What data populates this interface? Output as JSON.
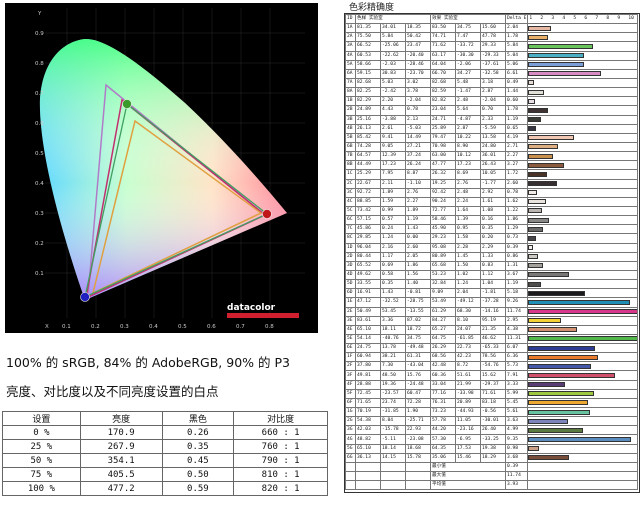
{
  "chromaticity": {
    "axis_x_label": "X",
    "axis_y_label": "Y",
    "x_ticks": [
      "0.1",
      "0.2",
      "0.3",
      "0.4",
      "0.5",
      "0.6",
      "0.7",
      "0.8"
    ],
    "y_ticks": [
      "0.9",
      "0.8",
      "0.7",
      "0.6",
      "0.5",
      "0.4",
      "0.3",
      "0.2",
      "0.1"
    ],
    "brand": "datacolor"
  },
  "caption_gamut": "100% 的 sRGB, 84% 的 AdobeRGB, 90% 的 P3",
  "caption_white": "亮度、对比度以及不同亮度设置的白点",
  "brightness_table": {
    "headers": [
      "设置",
      "亮度",
      "黑色",
      "对比度"
    ],
    "rows": [
      [
        "0 %",
        "170.9",
        "0.26",
        "660 : 1"
      ],
      [
        "25 %",
        "267.9",
        "0.35",
        "760 : 1"
      ],
      [
        "50 %",
        "354.1",
        "0.45",
        "790 : 1"
      ],
      [
        "75 %",
        "405.5",
        "0.50",
        "810 : 1"
      ],
      [
        "100 %",
        "477.2",
        "0.59",
        "820 : 1"
      ]
    ]
  },
  "delta_e": {
    "title": "色彩精确度",
    "header": [
      "ID",
      "色样",
      "实验室",
      "",
      "效果",
      "实验室",
      "",
      "Delta E"
    ],
    "scale": [
      "1",
      "2",
      "3",
      "4",
      "5",
      "6",
      "7",
      "8",
      "9",
      "10"
    ],
    "rows": [
      {
        "id": "1A",
        "v": [
          "81.35",
          "34.01",
          "18.35",
          "83.50",
          "34.75",
          "15.60"
        ],
        "de": "2.04",
        "c": "#e7b8a4"
      },
      {
        "id": "2A",
        "v": [
          "75.50",
          "5.84",
          "50.42",
          "74.71",
          "7.47",
          "47.78"
        ],
        "de": "1.78",
        "c": "#e9b06a"
      },
      {
        "id": "3A",
        "v": [
          "66.52",
          "-25.06",
          "23.47",
          "71.62",
          "-33.72",
          "29.33"
        ],
        "de": "5.84",
        "c": "#6ac45c"
      },
      {
        "id": "4A",
        "v": [
          "60.53",
          "-22.62",
          "-20.40",
          "63.17",
          "-30.30",
          "-29.33"
        ],
        "de": "5.04",
        "c": "#4aaec4"
      },
      {
        "id": "5A",
        "v": [
          "58.66",
          "-2.03",
          "-28.46",
          "64.04",
          "-2.06",
          "-37.61",
          "7.60"
        ],
        "de": "5.06",
        "c": "#7c9ed8"
      },
      {
        "id": "6A",
        "v": [
          "59.15",
          "30.83",
          "-23.70",
          "66.70",
          "34.27",
          "-32.58"
        ],
        "de": "6.61",
        "c": "#d88cc4"
      },
      {
        "id": "7A",
        "v": [
          "82.68",
          "5.03",
          "3.02",
          "82.68",
          "5.48",
          "3.18"
        ],
        "de": "0.49",
        "c": "#e8dcd6"
      },
      {
        "id": "8A",
        "v": [
          "82.25",
          "-2.42",
          "3.78",
          "82.59",
          "-1.47",
          "2.87"
        ],
        "de": "1.44",
        "c": "#e0e0d8"
      },
      {
        "id": "1B",
        "v": [
          "82.29",
          "2.20",
          "-2.04",
          "82.82",
          "2.48",
          "-2.04"
        ],
        "de": "0.60",
        "c": "#e8e0e6"
      },
      {
        "id": "2B",
        "v": [
          "24.89",
          "4.43",
          "0.78",
          "23.04",
          "5.64",
          "0.70"
        ],
        "de": "1.78",
        "c": "#3e3232"
      },
      {
        "id": "3B",
        "v": [
          "25.16",
          "-3.88",
          "2.13",
          "24.71",
          "-4.87",
          "2.33"
        ],
        "de": "1.19",
        "c": "#383c34"
      },
      {
        "id": "4B",
        "v": [
          "26.13",
          "2.61",
          "-5.03",
          "25.89",
          "2.87",
          "-5.59"
        ],
        "de": "0.65",
        "c": "#363642"
      },
      {
        "id": "5B",
        "v": [
          "85.42",
          "9.41",
          "14.49",
          "79.47",
          "10.22",
          "13.58"
        ],
        "de": "4.19",
        "c": "#f2c8b4"
      },
      {
        "id": "6B",
        "v": [
          "74.28",
          "9.05",
          "27.21",
          "70.98",
          "8.90",
          "24.80"
        ],
        "de": "2.71",
        "c": "#dcae82"
      },
      {
        "id": "7B",
        "v": [
          "64.57",
          "12.39",
          "37.24",
          "63.00",
          "10.12",
          "36.01"
        ],
        "de": "2.27",
        "c": "#c8904c"
      },
      {
        "id": "8B",
        "v": [
          "44.49",
          "17.23",
          "26.24",
          "47.77",
          "17.23",
          "26.43"
        ],
        "de": "3.27",
        "c": "#8c5a3c"
      },
      {
        "id": "1C",
        "v": [
          "25.29",
          "7.95",
          "8.87",
          "26.32",
          "8.69",
          "10.05"
        ],
        "de": "1.72",
        "c": "#4a3428"
      },
      {
        "id": "2C",
        "v": [
          "22.67",
          "2.11",
          "-1.10",
          "19.25",
          "2.76",
          "-1.77"
        ],
        "de": "2.60",
        "c": "#362e30"
      },
      {
        "id": "3C",
        "v": [
          "92.72",
          "1.89",
          "2.76",
          "92.42",
          "2.48",
          "2.92"
        ],
        "de": "0.78",
        "c": "#f2eae4"
      },
      {
        "id": "4C",
        "v": [
          "88.85",
          "1.59",
          "2.27",
          "90.24",
          "2.24",
          "1.61"
        ],
        "de": "1.62",
        "c": "#eae4de"
      },
      {
        "id": "5C",
        "v": [
          "73.42",
          "0.99",
          "1.89",
          "72.77",
          "1.64",
          "1.08"
        ],
        "de": "1.22",
        "c": "#bcb6b2"
      },
      {
        "id": "6C",
        "v": [
          "57.15",
          "0.57",
          "1.19",
          "58.46",
          "1.39",
          "0.16"
        ],
        "de": "1.86",
        "c": "#8a8886"
      },
      {
        "id": "7C",
        "v": [
          "45.86",
          "0.24",
          "1.43",
          "45.90",
          "0.95",
          "0.35"
        ],
        "de": "1.29",
        "c": "#6c6a68"
      },
      {
        "id": "8C",
        "v": [
          "29.85",
          "1.24",
          "0.00",
          "29.23",
          "1.58",
          "0.20"
        ],
        "de": "0.73",
        "c": "#48464a"
      },
      {
        "id": "1D",
        "v": [
          "96.04",
          "2.16",
          "2.60",
          "95.08",
          "2.28",
          "2.29"
        ],
        "de": "0.39",
        "c": "#f6f0ec"
      },
      {
        "id": "2D",
        "v": [
          "80.44",
          "1.17",
          "2.05",
          "80.89",
          "1.45",
          "1.33"
        ],
        "de": "0.86",
        "c": "#ccc8c4"
      },
      {
        "id": "3D",
        "v": [
          "65.52",
          "0.69",
          "1.86",
          "65.68",
          "1.50",
          "0.83"
        ],
        "de": "1.31",
        "c": "#a4a09c"
      },
      {
        "id": "4D",
        "v": [
          "49.62",
          "0.58",
          "1.56",
          "53.23",
          "1.02",
          "1.12"
        ],
        "de": "3.67",
        "c": "#7a7876"
      },
      {
        "id": "5D",
        "v": [
          "33.55",
          "0.35",
          "1.40",
          "32.84",
          "1.24",
          "1.04"
        ],
        "de": "1.19",
        "c": "#504e4c"
      },
      {
        "id": "6D",
        "v": [
          "16.91",
          "1.43",
          "-0.81",
          "9.09",
          "2.04",
          "-1.81"
        ],
        "de": "5.18",
        "c": "#1a1a1c"
      },
      {
        "id": "1E",
        "v": [
          "47.12",
          "-32.52",
          "-28.75",
          "53.49",
          "-49.12",
          "-37.28"
        ],
        "de": "9.26",
        "c": "#1e8eb4"
      },
      {
        "id": "2E",
        "v": [
          "50.49",
          "53.45",
          "-13.55",
          "61.29",
          "68.30",
          "-14.16"
        ],
        "de": "11.74",
        "c": "#d8388c"
      },
      {
        "id": "3E",
        "v": [
          "83.61",
          "3.36",
          "87.02",
          "84.27",
          "8.10",
          "95.19"
        ],
        "de": "2.95",
        "c": "#f2d234"
      },
      {
        "id": "4E",
        "v": [
          "65.10",
          "18.11",
          "18.72",
          "65.27",
          "24.07",
          "21.35"
        ],
        "de": "4.38",
        "c": "#d29070"
      },
      {
        "id": "5E",
        "v": [
          "54.14",
          "-40.76",
          "34.75",
          "64.75",
          "-61.85",
          "46.62"
        ],
        "de": "11.31",
        "c": "#52b84c"
      },
      {
        "id": "6E",
        "v": [
          "24.75",
          "13.78",
          "-49.48",
          "26.29",
          "22.73",
          "-65.33"
        ],
        "de": "6.07",
        "c": "#2c3c94"
      },
      {
        "id": "1F",
        "v": [
          "60.94",
          "38.21",
          "61.31",
          "68.56",
          "42.23",
          "78.56"
        ],
        "de": "6.36",
        "c": "#e87c2c"
      },
      {
        "id": "2F",
        "v": [
          "37.80",
          "7.30",
          "-43.04",
          "42.48",
          "8.72",
          "-54.76"
        ],
        "de": "5.73",
        "c": "#4458a8"
      },
      {
        "id": "3F",
        "v": [
          "49.81",
          "48.50",
          "15.76",
          "60.36",
          "51.61",
          "15.62"
        ],
        "de": "7.91",
        "c": "#d0506c"
      },
      {
        "id": "4F",
        "v": [
          "28.88",
          "19.36",
          "-24.48",
          "33.04",
          "21.99",
          "-29.37"
        ],
        "de": "3.33",
        "c": "#5a3c74"
      },
      {
        "id": "5F",
        "v": [
          "72.45",
          "-23.57",
          "60.47",
          "77.16",
          "-33.98",
          "71.61"
        ],
        "de": "5.99",
        "c": "#9ec840"
      },
      {
        "id": "6F",
        "v": [
          "71.65",
          "23.74",
          "72.28",
          "76.31",
          "20.89",
          "83.18"
        ],
        "de": "5.45",
        "c": "#eca830"
      },
      {
        "id": "1G",
        "v": [
          "70.19",
          "-31.85",
          "1.90",
          "73.23",
          "-44.93",
          "-0.56"
        ],
        "de": "5.61",
        "c": "#68c4a0"
      },
      {
        "id": "2G",
        "v": [
          "54.38",
          "8.84",
          "-25.71",
          "57.78",
          "11.05",
          "-30.01"
        ],
        "de": "3.63",
        "c": "#7c84bc"
      },
      {
        "id": "3G",
        "v": [
          "42.03",
          "-15.78",
          "22.93",
          "44.20",
          "-23.16",
          "26.40"
        ],
        "de": "4.99",
        "c": "#5a7a40"
      },
      {
        "id": "4G",
        "v": [
          "48.82",
          "-5.11",
          "-23.08",
          "57.30",
          "-6.95",
          "-33.25"
        ],
        "de": "9.35",
        "c": "#5a8cc0"
      },
      {
        "id": "5G",
        "v": [
          "65.10",
          "18.14",
          "18.68",
          "64.35",
          "17.53",
          "19.38"
        ],
        "de": "0.98",
        "c": "#caa088"
      },
      {
        "id": "6G",
        "v": [
          "36.13",
          "14.15",
          "15.78",
          "35.06",
          "15.46",
          "18.29"
        ],
        "de": "3.68",
        "c": "#7a4c3a"
      }
    ],
    "summary": [
      {
        "label": "最小值",
        "value": "0.39"
      },
      {
        "label": "最大值",
        "value": "11.74"
      },
      {
        "label": "平均值",
        "value": "3.93"
      }
    ]
  }
}
